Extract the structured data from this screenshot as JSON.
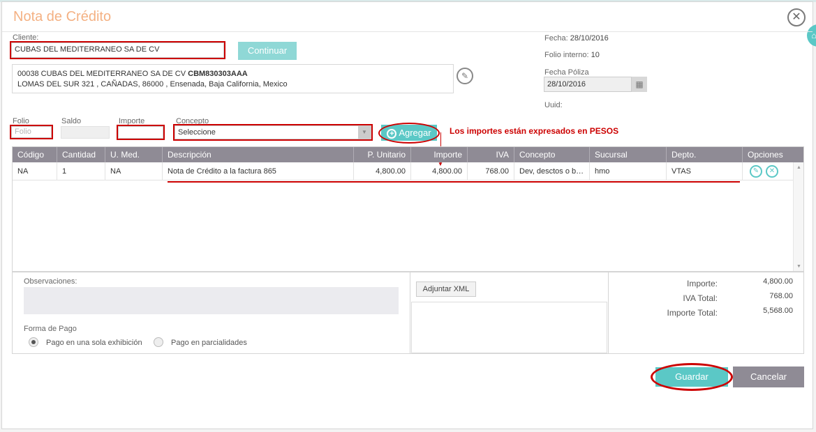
{
  "dialog": {
    "title": "Nota de Crédito",
    "close_icon": "close-icon",
    "side_tab_icon": "tag-icon"
  },
  "cliente": {
    "label": "Cliente:",
    "value": "CUBAS DEL MEDITERRANEO SA DE CV",
    "continuar_label": "Continuar",
    "address_line1_prefix": "00038 CUBAS DEL MEDITERRANEO SA DE CV",
    "rfc": "CBM830303AAA",
    "address_line2": "LOMAS DEL SUR 321 , CAÑADAS, 86000 , Ensenada, Baja California, Mexico",
    "edit_icon": "pencil-icon"
  },
  "info": {
    "fecha_label": "Fecha:",
    "fecha_value": "28/10/2016",
    "folio_interno_label": "Folio interno:",
    "folio_interno_value": "10",
    "fecha_poliza_label": "Fecha Póliza",
    "fecha_poliza_value": "28/10/2016",
    "calendar_icon": "calendar-icon",
    "uuid_label": "Uuid:"
  },
  "form": {
    "folio_label": "Folio",
    "folio_placeholder": "Folio",
    "saldo_label": "Saldo",
    "importe_label": "Importe",
    "concepto_label": "Concepto",
    "concepto_value": "Seleccione",
    "agregar_label": "Agregar",
    "note": "Los importes están expresados en PESOS"
  },
  "grid": {
    "columns": [
      "Código",
      "Cantidad",
      "U. Med.",
      "Descripción",
      "P. Unitario",
      "Importe",
      "IVA",
      "Concepto",
      "Sucursal",
      "Depto.",
      "Opciones"
    ],
    "rows": [
      {
        "codigo": "NA",
        "cantidad": "1",
        "umed": "NA",
        "descripcion": "Nota de Crédito a la factura 865",
        "punitario": "4,800.00",
        "importe": "4,800.00",
        "iva": "768.00",
        "concepto": "Dev, desctos o b…",
        "sucursal": "hmo",
        "depto": "VTAS"
      }
    ]
  },
  "bottom": {
    "observaciones_label": "Observaciones:",
    "forma_pago_label": "Forma de Pago",
    "pago_unico_label": "Pago en una sola exhibición",
    "pago_parcial_label": "Pago en parcialidades",
    "pago_selected": "Pago en una sola exhibición",
    "adjuntar_label": "Adjuntar XML",
    "importe_label": "Importe:",
    "importe_value": "4,800.00",
    "iva_label": "IVA Total:",
    "iva_value": "768.00",
    "total_label": "Importe Total:",
    "total_value": "5,568.00"
  },
  "actions": {
    "guardar_label": "Guardar",
    "cancelar_label": "Cancelar"
  },
  "colors": {
    "accent": "#5bc8c6",
    "title": "#f4b183",
    "header": "#8f8b95",
    "highlight": "#cc0000"
  }
}
